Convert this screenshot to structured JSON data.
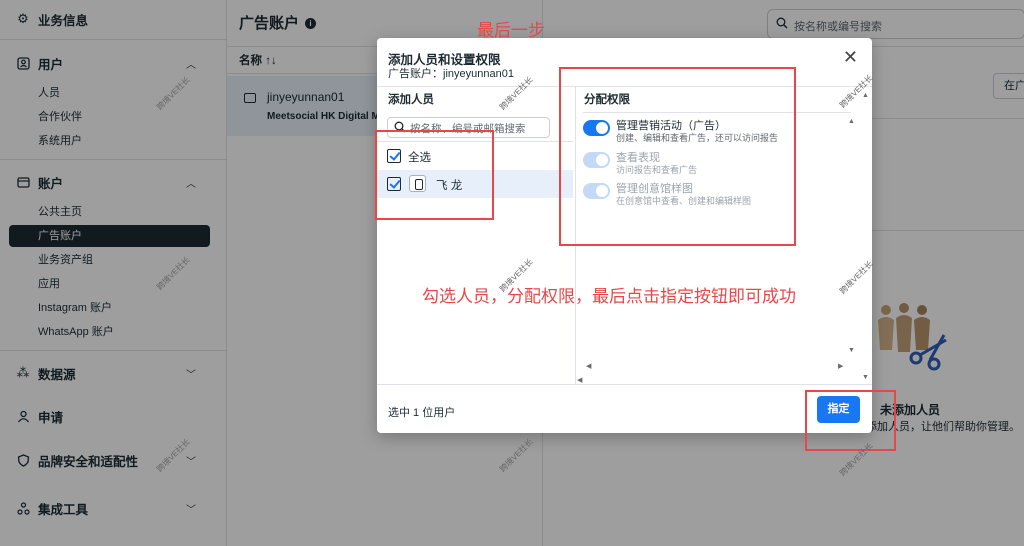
{
  "sidebar": {
    "business_info": "业务信息",
    "users": {
      "label": "用户",
      "items": [
        "人员",
        "合作伙伴",
        "系统用户"
      ]
    },
    "accounts": {
      "label": "账户",
      "items": [
        "公共主页",
        "广告账户",
        "业务资产组",
        "应用",
        "Instagram 账户",
        "WhatsApp 账户"
      ]
    },
    "data_sources": "数据源",
    "requests": "申请",
    "brand_safety": "品牌安全和适配性",
    "integrations": "集成工具"
  },
  "mid": {
    "title": "广告账户",
    "col_name": "名称 ↑↓",
    "account_name": "jinyeyunnan01",
    "business": "Meetsocial HK Digital Ma"
  },
  "right": {
    "search_placeholder": "按名称或编号搜索",
    "btn_partial": "在广",
    "empty_title": "未添加人员",
    "empty_sub": "添加人员，让他们帮助你管理。"
  },
  "modal": {
    "title": "添加人员和设置权限",
    "subtitle": "广告账户：jinyeyunnan01",
    "left_header": "添加人员",
    "search_placeholder": "按名称、编号或邮箱搜索",
    "select_all": "全选",
    "user": "飞 龙",
    "right_header": "分配权限",
    "permissions": [
      {
        "title": "管理营销活动（广告）",
        "desc": "创建、编辑和查看广告，还可以访问报告",
        "enabled": true
      },
      {
        "title": "查看表现",
        "desc": "访问报告和查看广告",
        "enabled": true
      },
      {
        "title": "管理创意馆样图",
        "desc": "在创意馆中查看、创建和编辑样图",
        "enabled": true
      }
    ],
    "footer_count": "选中 1 位用户",
    "assign_button": "指定"
  },
  "annotations": {
    "step": "最后一步",
    "instruction": "勾选人员，分配权限，最后点击指定按钮即可成功",
    "watermark": "跨境VE社长",
    "color": "#e8474a"
  }
}
